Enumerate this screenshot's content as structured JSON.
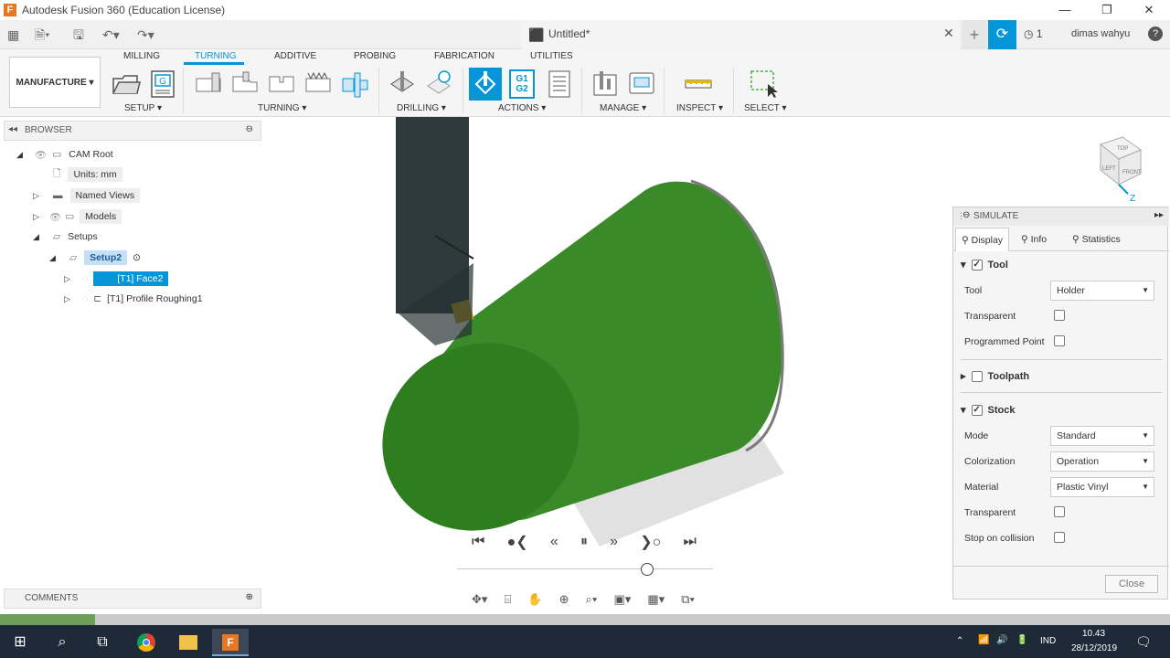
{
  "window": {
    "title": "Autodesk Fusion 360 (Education License)",
    "logo_letter": "F",
    "controls": [
      "—",
      "❐",
      "✕"
    ]
  },
  "qat": {
    "doc_title": "Untitled*",
    "doc_close": "✕",
    "plus": "+",
    "sync_icon": "⟳",
    "job_count": "1",
    "user_name": "dimas wahyu",
    "help": "?"
  },
  "ribbon": {
    "workspace": "MANUFACTURE",
    "tabs": [
      "MILLING",
      "TURNING",
      "ADDITIVE",
      "PROBING",
      "FABRICATION",
      "UTILITIES"
    ],
    "active_tab": "TURNING",
    "groups": [
      "SETUP",
      "TURNING",
      "DRILLING",
      "ACTIONS",
      "MANAGE",
      "INSPECT",
      "SELECT"
    ],
    "g_code_label": "G1\nG2"
  },
  "browser": {
    "title": "BROWSER",
    "items": [
      {
        "label": "CAM Root"
      },
      {
        "label": "Units: mm"
      },
      {
        "label": "Named Views"
      },
      {
        "label": "Models"
      },
      {
        "label": "Setups"
      },
      {
        "label": "Setup2"
      },
      {
        "label": "[T1] Face2"
      },
      {
        "label": "[T1] Profile Roughing1"
      }
    ]
  },
  "simulate": {
    "title": "SIMULATE",
    "tabs": [
      "Display",
      "Info",
      "Statistics"
    ],
    "tool_section": "Tool",
    "tool_label": "Tool",
    "tool_value": "Holder",
    "transparent_label": "Transparent",
    "programmed_point_label": "Programmed Point",
    "toolpath_section": "Toolpath",
    "stock_section": "Stock",
    "mode_label": "Mode",
    "mode_value": "Standard",
    "colorization_label": "Colorization",
    "colorization_value": "Operation",
    "material_label": "Material",
    "material_value": "Plastic Vinyl",
    "stock_transparent_label": "Transparent",
    "stop_collision_label": "Stop on collision",
    "close_label": "Close"
  },
  "comments": {
    "title": "COMMENTS"
  },
  "taskbar": {
    "lang": "IND",
    "time": "10.43",
    "date": "28/12/2019"
  },
  "viewcube": {
    "top": "TOP",
    "left": "LEFT",
    "front": "FRONT",
    "axis": "Z"
  },
  "colors": {
    "accent": "#0696d7",
    "stock_green": "#3f8f2a",
    "taskbar": "#1f2a38"
  }
}
